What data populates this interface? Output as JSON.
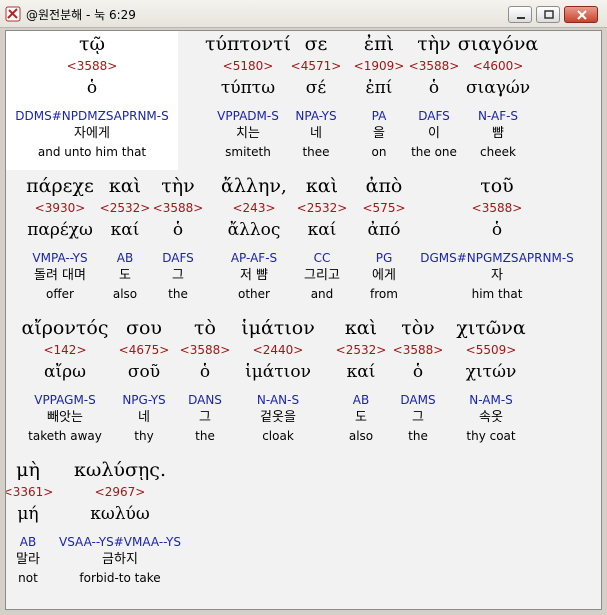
{
  "window": {
    "title": "@원전분해 - 눅 6:29"
  },
  "colors": {
    "strong": "#a01818",
    "parse": "#1a24b0",
    "highlight": "#ffffff"
  },
  "rows": [
    {
      "words": [
        {
          "greek": "τῷ",
          "strong": "<3588>",
          "lemma": "ὁ",
          "parse": "DDMS#NPDMZSAPRNM-S",
          "korean": "자에게",
          "english": "and unto him that"
        },
        {
          "greek": "τύπτοντί",
          "strong": "<5180>",
          "lemma": "τύπτω",
          "parse": "VPPADM-S",
          "korean": "치는",
          "english": "smiteth"
        },
        {
          "greek": "σε",
          "strong": "<4571>",
          "lemma": "σέ",
          "parse": "NPA-YS",
          "korean": "네",
          "english": "thee"
        },
        {
          "greek": "ἐπὶ",
          "strong": "<1909>",
          "lemma": "ἐπί",
          "parse": "PA",
          "korean": "을",
          "english": "on"
        },
        {
          "greek": "τὴν",
          "strong": "<3588>",
          "lemma": "ὁ",
          "parse": "DAFS",
          "korean": "이",
          "english": "the one"
        },
        {
          "greek": "σιαγόνα",
          "strong": "<4600>",
          "lemma": "σιαγών",
          "parse": "N-AF-S",
          "korean": "뺨",
          "english": "cheek"
        }
      ]
    },
    {
      "words": [
        {
          "greek": "πάρεχε",
          "strong": "<3930>",
          "lemma": "παρέχω",
          "parse": "VMPA--YS",
          "korean": "돌려 대며",
          "english": "offer"
        },
        {
          "greek": "καὶ",
          "strong": "<2532>",
          "lemma": "καί",
          "parse": "AB",
          "korean": "도",
          "english": "also"
        },
        {
          "greek": "τὴν",
          "strong": "<3588>",
          "lemma": "ὁ",
          "parse": "DAFS",
          "korean": "그",
          "english": "the"
        },
        {
          "greek": "ἄλλην,",
          "strong": "<243>",
          "lemma": "ἄλλος",
          "parse": "AP-AF-S",
          "korean": "저 뺨",
          "english": "other"
        },
        {
          "greek": "καὶ",
          "strong": "<2532>",
          "lemma": "καί",
          "parse": "CC",
          "korean": "그리고",
          "english": "and"
        },
        {
          "greek": "ἀπὸ",
          "strong": "<575>",
          "lemma": "ἀπό",
          "parse": "PG",
          "korean": "에게",
          "english": "from"
        },
        {
          "greek": "τοῦ",
          "strong": "<3588>",
          "lemma": "ὁ",
          "parse": "DGMS#NPGMZSAPRNM-S",
          "korean": "자",
          "english": "him that"
        }
      ]
    },
    {
      "words": [
        {
          "greek": "αἴροντός",
          "strong": "<142>",
          "lemma": "αἴρω",
          "parse": "VPPAGM-S",
          "korean": "빼앗는",
          "english": "taketh away"
        },
        {
          "greek": "σου",
          "strong": "<4675>",
          "lemma": "σοῦ",
          "parse": "NPG-YS",
          "korean": "네",
          "english": "thy"
        },
        {
          "greek": "τὸ",
          "strong": "<3588>",
          "lemma": "ὁ",
          "parse": "DANS",
          "korean": "그",
          "english": "the"
        },
        {
          "greek": "ἱμάτιον",
          "strong": "<2440>",
          "lemma": "ἱμάτιον",
          "parse": "N-AN-S",
          "korean": "겉옷을",
          "english": "cloak"
        },
        {
          "greek": "καὶ",
          "strong": "<2532>",
          "lemma": "καί",
          "parse": "AB",
          "korean": "도",
          "english": "also"
        },
        {
          "greek": "τὸν",
          "strong": "<3588>",
          "lemma": "ὁ",
          "parse": "DAMS",
          "korean": "그",
          "english": "the"
        },
        {
          "greek": "χιτῶνα",
          "strong": "<5509>",
          "lemma": "χιτών",
          "parse": "N-AM-S",
          "korean": "속옷",
          "english": "thy coat"
        }
      ]
    },
    {
      "words": [
        {
          "greek": "μὴ",
          "strong": "<3361>",
          "lemma": "μή",
          "parse": "AB",
          "korean": "말라",
          "english": "not"
        },
        {
          "greek": "κωλύσῃς.",
          "strong": "<2967>",
          "lemma": "κωλύω",
          "parse": "VSAA--YS#VMAA--YS",
          "korean": "금하지",
          "english": "forbid-to take"
        }
      ]
    }
  ]
}
